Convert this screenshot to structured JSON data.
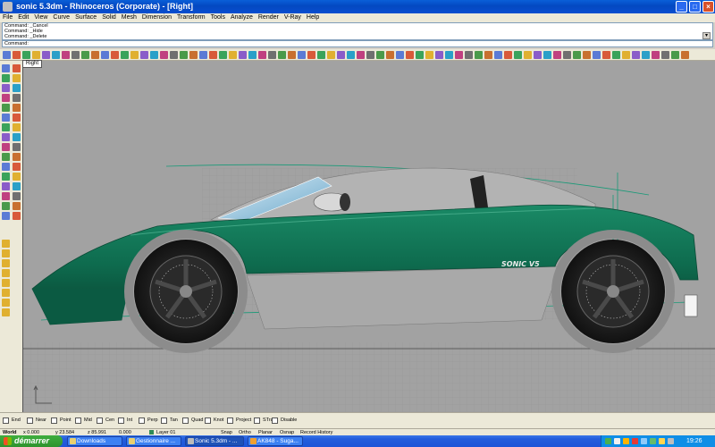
{
  "window": {
    "title": "sonic 5.3dm - Rhinoceros (Corporate) - [Right]"
  },
  "menu": [
    "File",
    "Edit",
    "View",
    "Curve",
    "Surface",
    "Solid",
    "Mesh",
    "Dimension",
    "Transform",
    "Tools",
    "Analyze",
    "Render",
    "V-Ray",
    "Help"
  ],
  "command_history": [
    "Command: _Cancel",
    "Command: _Hide",
    "Command: _Delete"
  ],
  "command_prompt": "Command:",
  "viewport": {
    "label": "Right",
    "badge_text": "SONIC V5"
  },
  "osnaps": [
    "End",
    "Near",
    "Point",
    "Mid",
    "Cen",
    "Int",
    "Perp",
    "Tan",
    "Quad",
    "Knot",
    "Project",
    "STrack",
    "Disable"
  ],
  "status": {
    "cplane": "World",
    "x": "x 0.000",
    "y": "y 23.584",
    "z": "z 85.991",
    "delta": "0.000",
    "layer": "Layer 01",
    "snap": "Snap",
    "ortho": "Ortho",
    "planar": "Planar",
    "osnap": "Osnap",
    "history": "Record History"
  },
  "taskbar": {
    "start": "démarrer",
    "tasks": [
      "Downloads",
      "Gestionnaire ...",
      "Sonic 5.3dm - ...",
      "AK848 - Suga..."
    ],
    "clock": "19:26"
  },
  "colors": {
    "car_body": "#0e6b4e",
    "viewport_bg": "#a2a2a2",
    "titlebar": "#0a4fd0"
  }
}
